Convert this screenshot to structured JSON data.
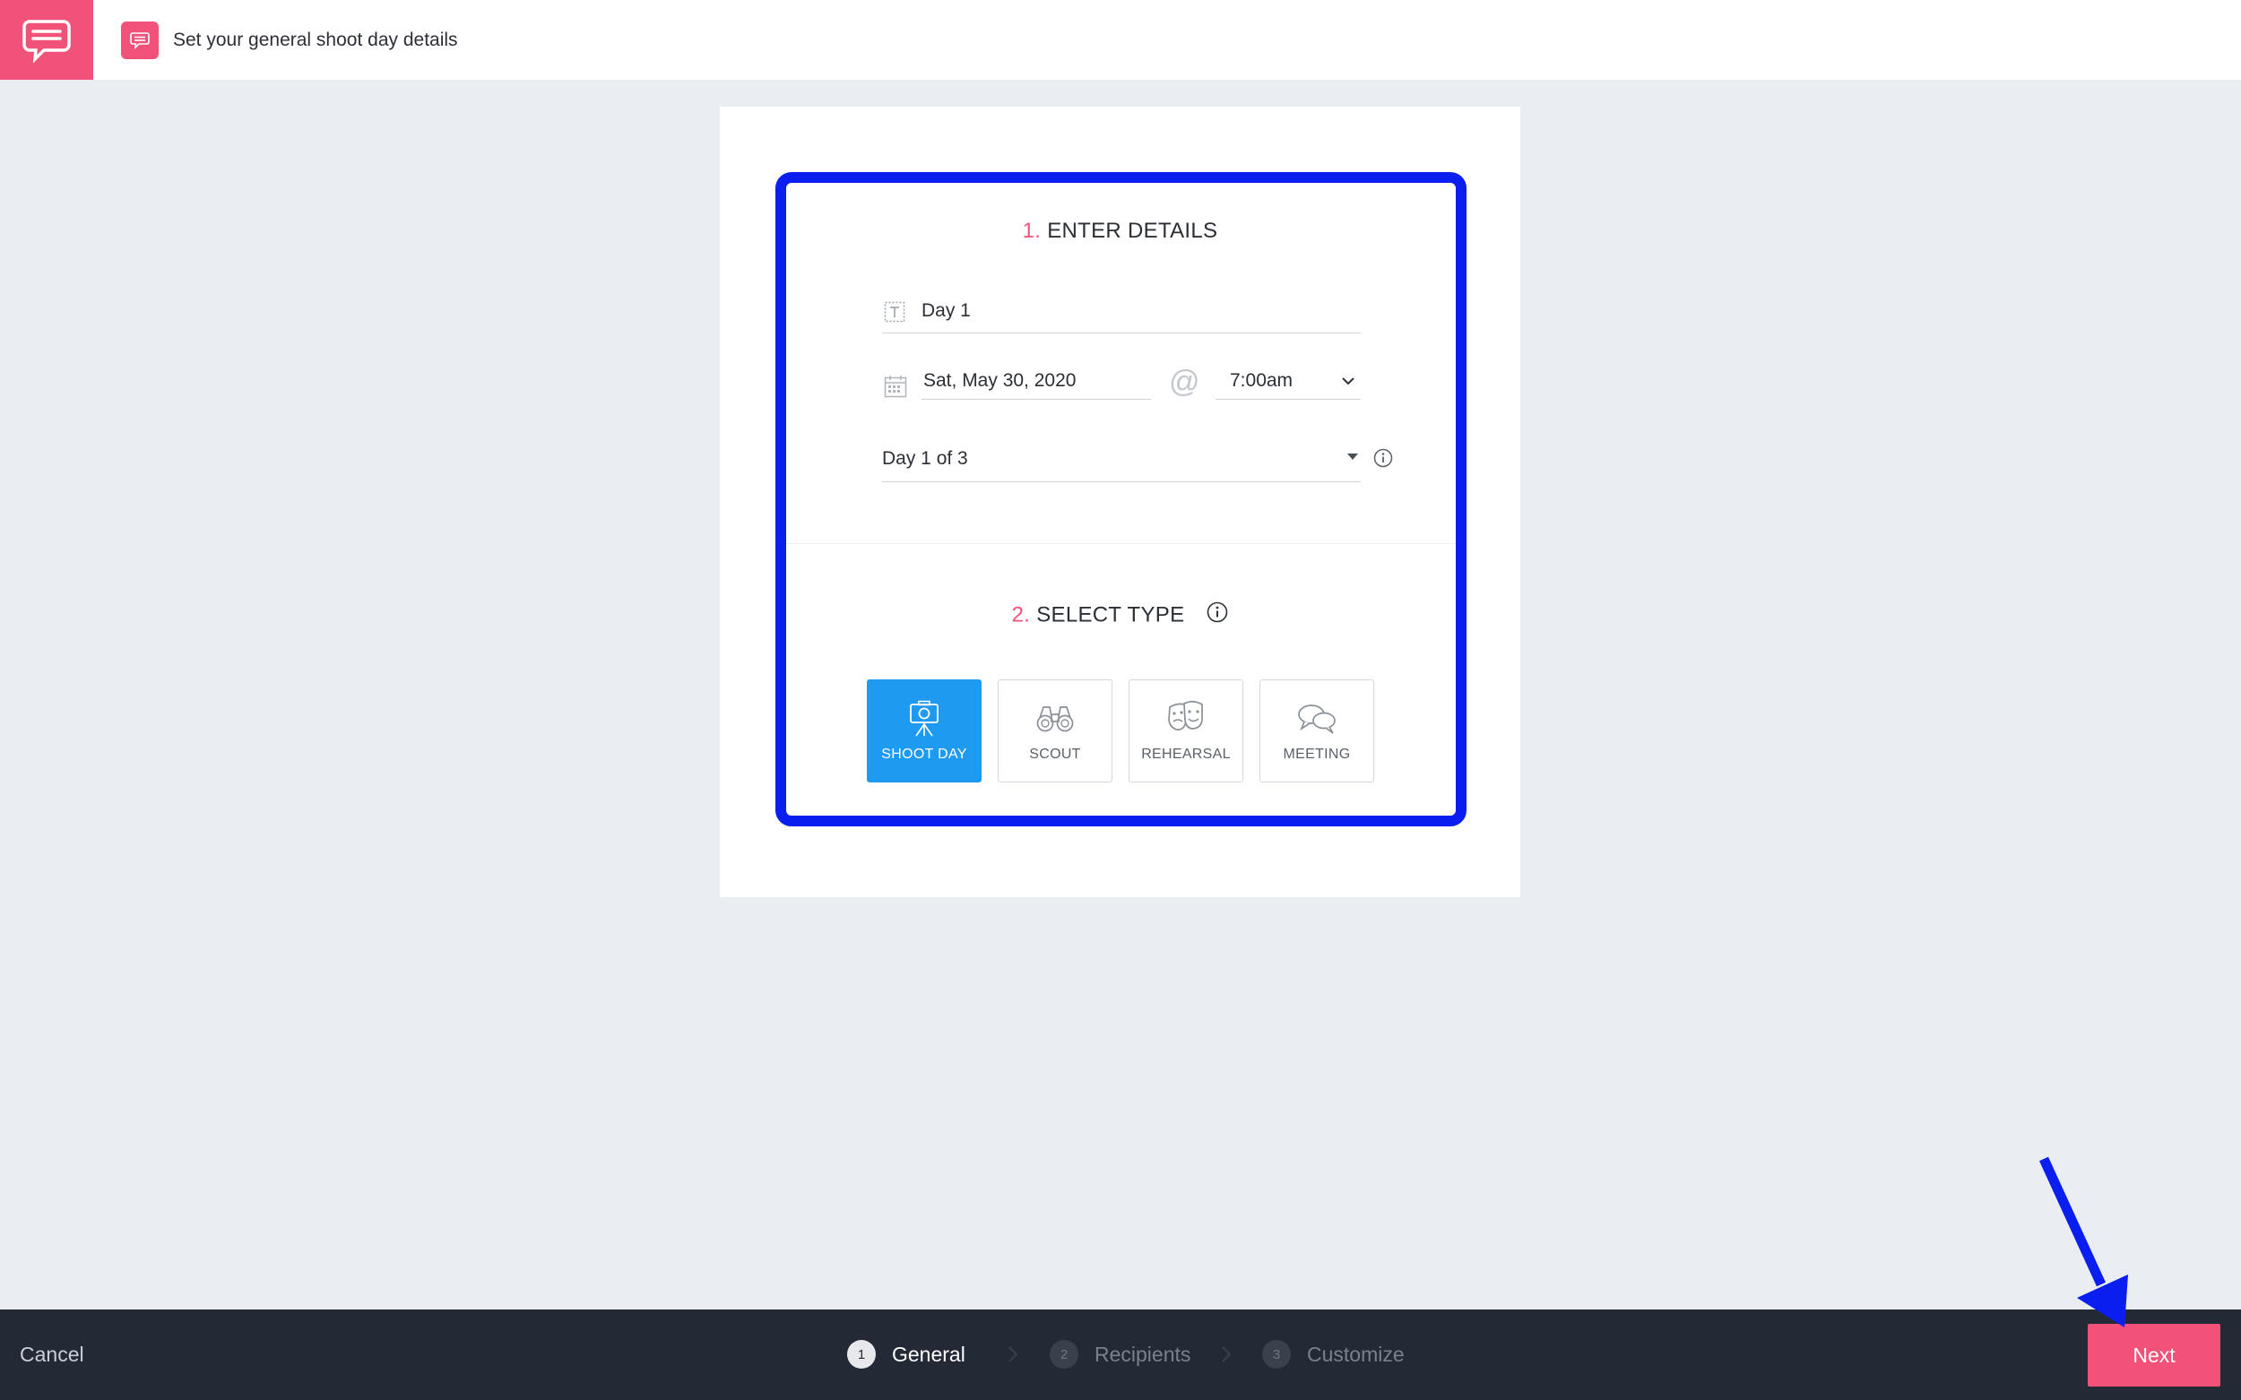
{
  "header": {
    "title": "Set your general shoot day details",
    "logo_icon": "chat-bubble-icon",
    "badge_icon": "chat-bubble-icon",
    "accent_color": "#f0527a"
  },
  "enter_details": {
    "number": "1.",
    "title": "ENTER DETAILS",
    "name_value": "Day 1",
    "date_value": "Sat, May 30, 2020",
    "at_symbol": "@",
    "time_value": "7:00am",
    "day_of_value": "Day 1 of 3"
  },
  "select_type": {
    "number": "2.",
    "title": "SELECT TYPE",
    "options": [
      {
        "label": "SHOOT DAY",
        "icon": "camera-tripod-icon",
        "selected": true
      },
      {
        "label": "SCOUT",
        "icon": "binoculars-icon",
        "selected": false
      },
      {
        "label": "REHEARSAL",
        "icon": "theater-masks-icon",
        "selected": false
      },
      {
        "label": "MEETING",
        "icon": "speech-bubbles-icon",
        "selected": false
      }
    ],
    "selected_color": "#1e9bf0"
  },
  "footer": {
    "cancel_label": "Cancel",
    "steps": [
      {
        "number": "1",
        "label": "General",
        "active": true
      },
      {
        "number": "2",
        "label": "Recipients",
        "active": false
      },
      {
        "number": "3",
        "label": "Customize",
        "active": false
      }
    ],
    "next_label": "Next"
  },
  "annotations": {
    "highlight_color": "#0a1ef0"
  }
}
